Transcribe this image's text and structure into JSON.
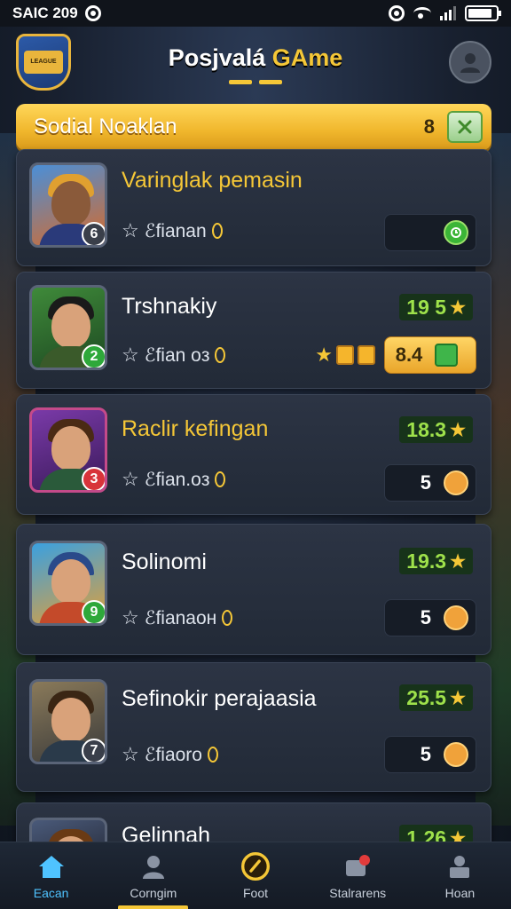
{
  "status_bar": {
    "time": "SAIC 209",
    "battery_percent": 88
  },
  "header": {
    "title_part1": "Posjvalá ",
    "title_part2": "GAme",
    "logo_text": "LEAGUE"
  },
  "banner": {
    "title": "Sodial Noaklan",
    "count": "8"
  },
  "players": [
    {
      "name": "Varinglak pemasin",
      "meta": "ℰfianan",
      "level": "6",
      "action_value": ""
    },
    {
      "name": "Trshnakiy",
      "meta": "ℰfian oз",
      "level": "2",
      "score": "19 5",
      "action_value": "8.4"
    },
    {
      "name": "Raclir kefingan",
      "meta": "ℰfian.oз",
      "level": "3",
      "score": "18.3",
      "action_value": "5"
    },
    {
      "name": "Solinomi",
      "meta": "ℰfianaoн",
      "level": "9",
      "score": "19.3",
      "action_value": "5"
    },
    {
      "name": "Sefinokir perajaasia",
      "meta": "ℰfiaoro",
      "level": "7",
      "score": "25.5",
      "action_value": "5"
    },
    {
      "name": "Gelinnah",
      "score": "1 26"
    }
  ],
  "bottom_nav": [
    {
      "label": "Eacan",
      "icon": "home-icon"
    },
    {
      "label": "Corngim",
      "icon": "user-icon"
    },
    {
      "label": "Foot",
      "icon": "ball-icon"
    },
    {
      "label": "Stalrarens",
      "icon": "notification-icon"
    },
    {
      "label": "Hoan",
      "icon": "profile-icon"
    }
  ],
  "colors": {
    "accent_gold": "#f5c737",
    "score_green": "#9ee14b",
    "active_nav": "#4fc3ff"
  }
}
